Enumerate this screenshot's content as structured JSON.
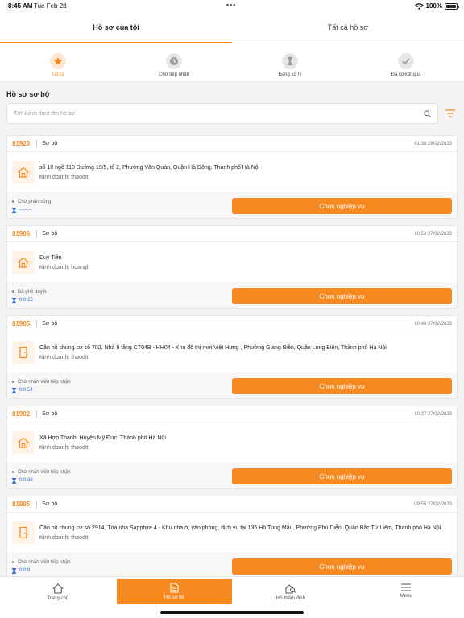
{
  "status_bar": {
    "time": "8:45 AM",
    "date": "Tue Feb 28",
    "battery": "100%"
  },
  "top_tabs": [
    {
      "label": "Hồ sơ của tôi",
      "active": true
    },
    {
      "label": "Tất cả hồ sơ",
      "active": false
    }
  ],
  "filters": [
    {
      "label": "Tất cả",
      "icon": "star-icon",
      "active": true
    },
    {
      "label": "Chờ tiếp nhận",
      "icon": "clock-icon",
      "active": false
    },
    {
      "label": "Đang xử lý",
      "icon": "hourglass-icon",
      "active": false
    },
    {
      "label": "Đã có kết quả",
      "icon": "check-icon",
      "active": false
    }
  ],
  "section_title": "Hồ sơ sơ bộ",
  "search": {
    "placeholder": "Tìm kiếm theo tên hồ sơ",
    "value": ""
  },
  "cards": [
    {
      "id": "81923",
      "type": "Sơ bộ",
      "time": "01:38 28/02/2023",
      "icon": "house-icon",
      "address": "số 10 ngõ 110 Đường 19/5, tổ 2, Phường Văn Quán, Quận Hà Đông, Thành phố Hà Nội",
      "sales": "Kinh doanh: thaodtt",
      "state": "Chờ phân công",
      "timer": "--:--:--",
      "button": "Chọn nghiệp vụ"
    },
    {
      "id": "81906",
      "type": "Sơ bộ",
      "time": "10:53 27/02/2023",
      "icon": "house-icon",
      "address": "Duy Tiên",
      "sales": "Kinh doanh: hoanglt",
      "state": "Đã phê duyệt",
      "timer": "0:0:25",
      "button": "Chọn nghiệp vụ"
    },
    {
      "id": "81905",
      "type": "Sơ bộ",
      "time": "10:48 27/02/2023",
      "icon": "door-icon",
      "address": "Căn hộ chung cư số 702, Nhà 9 tầng CT04B - HH04 - Khu đô thị mới Việt Hưng , Phường Giang Biên, Quận Long Biên, Thành phố Hà Nội",
      "sales": "Kinh doanh: thaodtt",
      "state": "Chờ nhân viên tiếp nhận",
      "timer": "0:0:54",
      "button": "Chọn nghiệp vụ"
    },
    {
      "id": "81902",
      "type": "Sơ bộ",
      "time": "10:37 27/02/2023",
      "icon": "house-icon",
      "address": "Xã Hợp Thanh, Huyện Mỹ Đức, Thành phố Hà Nội",
      "sales": "Kinh doanh: thaodtt",
      "state": "Chờ nhân viên tiếp nhận",
      "timer": "0:0:38",
      "button": "Chọn nghiệp vụ"
    },
    {
      "id": "81895",
      "type": "Sơ bộ",
      "time": "09:55 27/02/2023",
      "icon": "door-icon",
      "address": "Căn hộ chung cư số 2914, Tòa nhà Sapphire 4 - Khu nhà ở, văn phòng, dịch vụ tại 136 Hồ Tùng Mậu, Phường Phú Diễn, Quận Bắc Từ Liêm, Thành phố Hà Nội",
      "sales": "Kinh doanh: thaodtt",
      "state": "Chờ nhân viên tiếp nhận",
      "timer": "0:0:9",
      "button": "Chọn nghiệp vụ"
    }
  ],
  "bottom_nav": [
    {
      "label": "Trang chủ",
      "icon": "home-icon",
      "active": false
    },
    {
      "label": "HS sơ bộ",
      "icon": "document-icon",
      "active": true
    },
    {
      "label": "HS thẩm định",
      "icon": "appraisal-icon",
      "active": false
    },
    {
      "label": "Menu",
      "icon": "menu-icon",
      "active": false
    }
  ],
  "colors": {
    "accent": "#f6891f",
    "timer": "#2e6fd1"
  }
}
